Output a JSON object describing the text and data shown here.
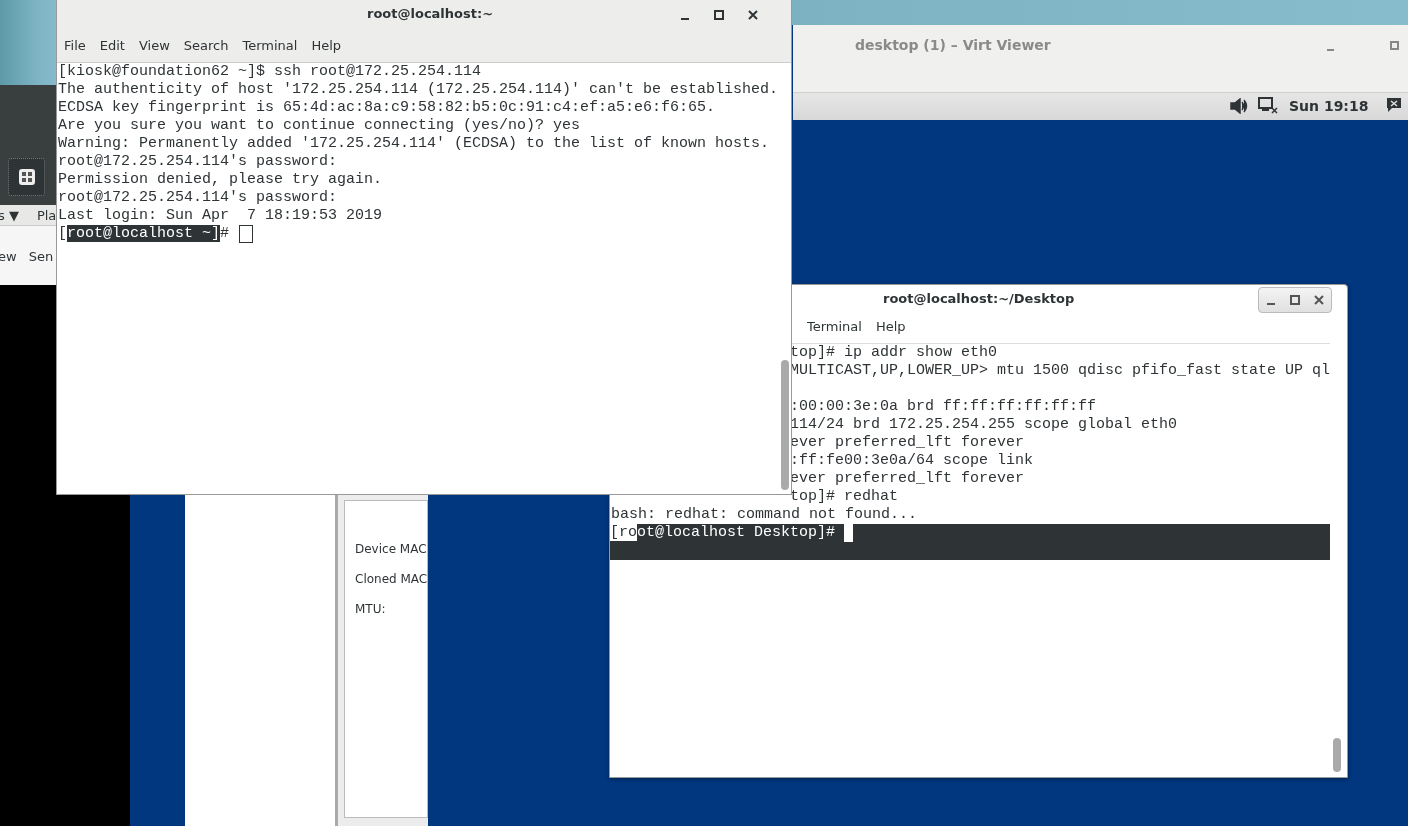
{
  "left_app": {
    "menu_texts": [
      "s ▼",
      "Pla"
    ],
    "tab_texts": [
      "ew",
      "Sen"
    ]
  },
  "virt_viewer": {
    "title": "desktop (1) – Virt Viewer",
    "top_bar": {
      "clock": "Sun 19:18"
    }
  },
  "network_settings": {
    "labels": [
      "Device MAC",
      "Cloned MAC",
      "MTU:"
    ]
  },
  "terminal_desktop": {
    "title": "root@localhost:~/Desktop",
    "menu": [
      "Terminal",
      "Help"
    ],
    "partial_blocks": [
      [
        "top]# ip addr show eth0",
        "MULTICAST,UP,LOWER_UP> mtu 1500 qdisc pfifo_fast state UP ql"
      ],
      [
        ":00:00:3e:0a brd ff:ff:ff:ff:ff:ff",
        "114/24 brd 172.25.254.255 scope global eth0",
        "ever preferred_lft forever",
        ":ff:fe00:3e0a/64 scope link",
        "ever preferred_lft forever",
        "top]# redhat"
      ]
    ],
    "lines": [
      "bash: redhat: command not found..."
    ],
    "prompt": [
      {
        "text": "[ro",
        "selected": false
      },
      {
        "text": "ot@localhost Desktop]# ",
        "selected": true
      }
    ],
    "cursor_focused": true
  },
  "terminal_main": {
    "title": "root@localhost:~",
    "menu": [
      "File",
      "Edit",
      "View",
      "Search",
      "Terminal",
      "Help"
    ],
    "lines": [
      "[kiosk@foundation62 ~]$ ssh root@172.25.254.114",
      "The authenticity of host '172.25.254.114 (172.25.254.114)' can't be established.",
      "ECDSA key fingerprint is 65:4d:ac:8a:c9:58:82:b5:0c:91:c4:ef:a5:e6:f6:65.",
      "Are you sure you want to continue connecting (yes/no)? yes",
      "Warning: Permanently added '172.25.254.114' (ECDSA) to the list of known hosts.",
      "root@172.25.254.114's password:",
      "Permission denied, please try again.",
      "root@172.25.254.114's password:",
      "Last login: Sun Apr  7 18:19:53 2019"
    ],
    "prompt": [
      {
        "text": "[",
        "selected": false
      },
      {
        "text": "root@localhost ~]",
        "selected": true
      },
      {
        "text": "# ",
        "selected": false
      }
    ],
    "cursor_focused": false
  }
}
